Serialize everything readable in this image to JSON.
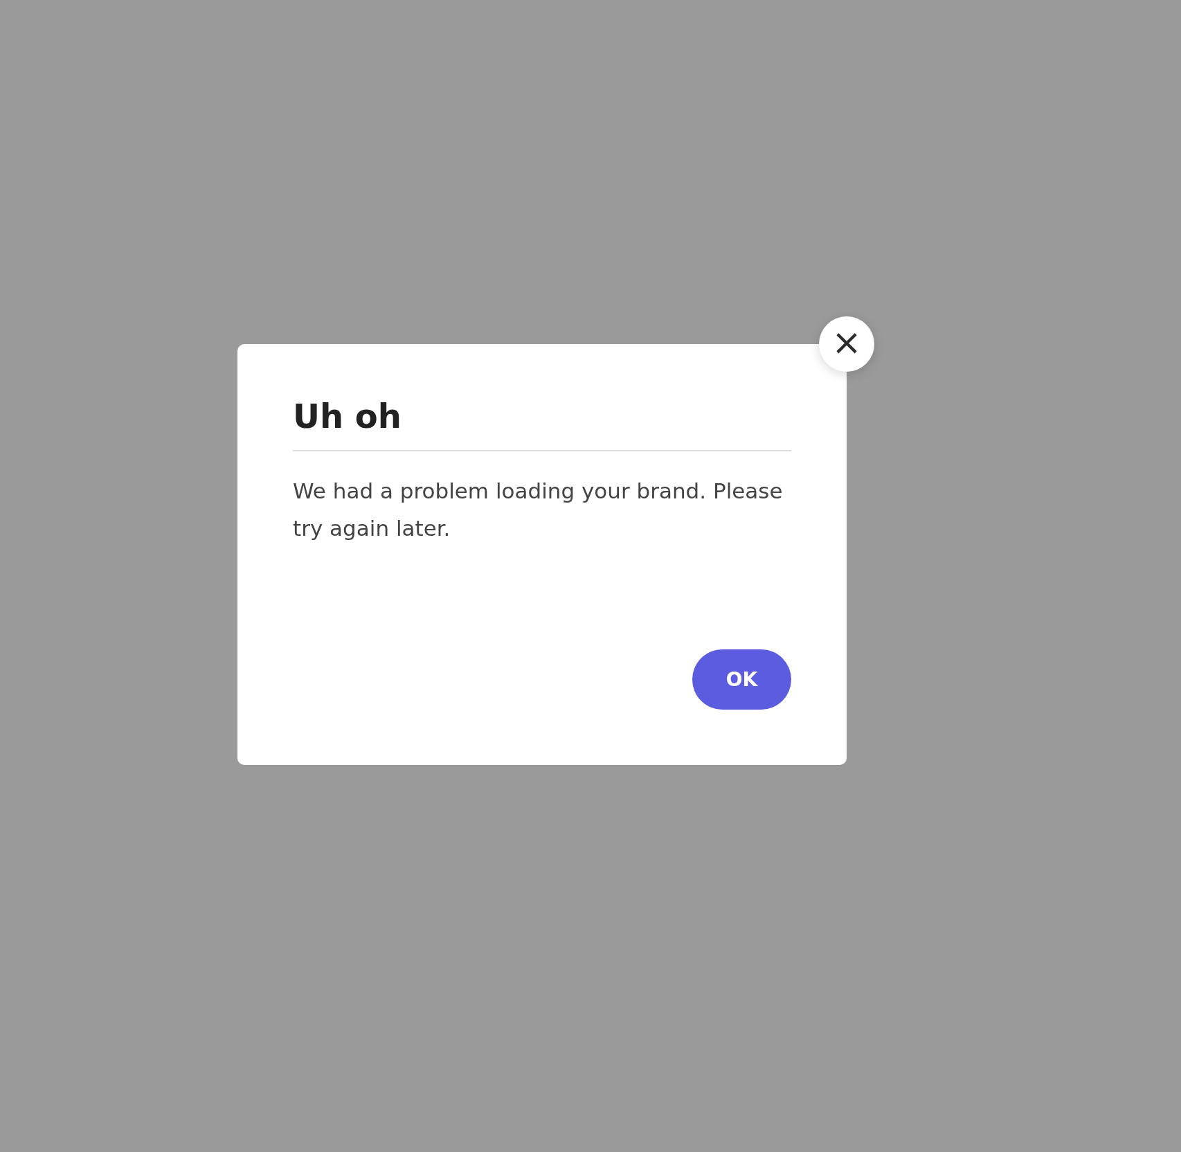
{
  "dialog": {
    "title": "Uh oh",
    "message": "We had a problem loading your brand. Please try again later.",
    "close_button": {
      "label": "×"
    },
    "buttons": [
      "OK"
    ]
  }
}
